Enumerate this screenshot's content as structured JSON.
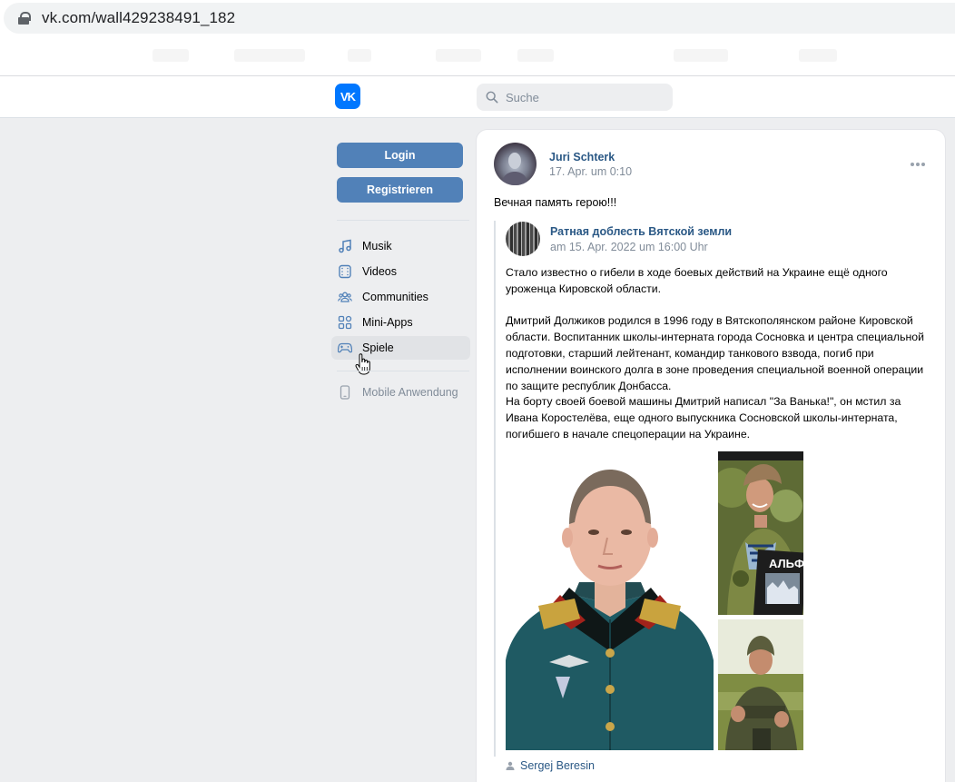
{
  "browser": {
    "url": "vk.com/wall429238491_182"
  },
  "header": {
    "logo_text": "VK",
    "search_placeholder": "Suche"
  },
  "sidebar": {
    "login_label": "Login",
    "register_label": "Registrieren",
    "items": [
      {
        "label": "Musik",
        "icon": "music-icon"
      },
      {
        "label": "Videos",
        "icon": "video-icon"
      },
      {
        "label": "Communities",
        "icon": "communities-icon"
      },
      {
        "label": "Mini-Apps",
        "icon": "apps-icon"
      },
      {
        "label": "Spiele",
        "icon": "gamepad-icon"
      }
    ],
    "mobile_label": "Mobile Anwendung"
  },
  "post": {
    "author": "Juri Schterk",
    "date": "17. Apr. um 0:10",
    "text": "Вечная память герою!!!",
    "repost": {
      "author": "Ратная доблесть Вятской земли",
      "date": "am 15. Apr. 2022 um 16:00 Uhr",
      "paragraphs": [
        "Стало известно о гибели в ходе боевых действий на Украине ещё одного уроженца Кировской области.",
        "",
        "Дмитрий Должиков родился в 1996 году в Вятскополянском районе Кировской области. Воспитанник школы-интерната города Сосновка и центра специальной подготовки, старший лейтенант, командир танкового взвода, погиб при исполнении воинского долга в зоне проведения специальной военной операции по защите республик Донбасса.",
        "На борту своей боевой машины Дмитрий написал \"За Ванька!\", он мстил за Ивана Коростелёва, еще одного выпускника Сосновской школы-интерната, погибшего в начале спецоперации на Украине."
      ],
      "photo_sign_text": "АЛЬФ",
      "credit": "Sergej Beresin"
    }
  },
  "colors": {
    "link": "#2a5885",
    "button": "#5181b8",
    "vk_blue": "#0077ff",
    "muted": "#818c99"
  }
}
